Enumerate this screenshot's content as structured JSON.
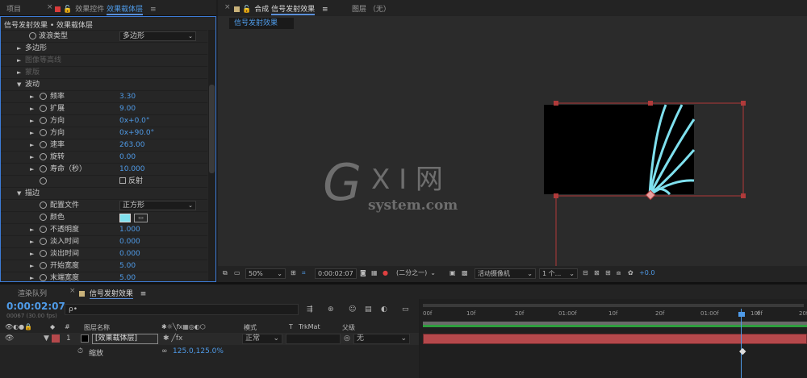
{
  "left_tabs": {
    "project": "项目",
    "effect_controls_prefix": "效果控件",
    "effect_controls_layer": "效果载体层"
  },
  "right_tabs": {
    "comp_prefix": "合成",
    "comp_name": "信号发射效果",
    "layer_label": "图层 （无）",
    "comp_subtab": "信号发射效果"
  },
  "effect_controls": {
    "title": "信号发射效果 • 效果载体层",
    "wave_type_label": "波浪类型",
    "wave_type_value": "多边形",
    "polygon": "多边形",
    "image_contour": "图像等高线",
    "mask": "蒙版",
    "wave_motion": "波动",
    "frequency_label": "频率",
    "frequency_value": "3.30",
    "expansion_label": "扩展",
    "expansion_value": "9.00",
    "direction1_label": "方向",
    "direction1_value": "0x+0.0°",
    "direction2_label": "方向",
    "direction2_value": "0x+90.0°",
    "velocity_label": "速率",
    "velocity_value": "263.00",
    "spin_label": "旋转",
    "spin_value": "0.00",
    "lifespan_label": "寿命（秒）",
    "lifespan_value": "10.000",
    "reflection_label": "反射",
    "stroke": "描边",
    "profile_label": "配置文件",
    "profile_value": "正方形",
    "color_label": "颜色",
    "color_value": "#7fe0ee",
    "opacity_label": "不透明度",
    "opacity_value": "1.000",
    "fade_in_label": "淡入时间",
    "fade_in_value": "0.000",
    "fade_out_label": "淡出时间",
    "fade_out_value": "0.000",
    "start_width_label": "开始宽度",
    "start_width_value": "5.00",
    "end_width_label": "末端宽度",
    "end_width_value": "5.00"
  },
  "viewer": {
    "watermark_g": "G",
    "watermark_xi": "X I 网",
    "watermark_domain": "system.com",
    "wave_color": "#7fe0ee"
  },
  "viewer_toolbar": {
    "zoom": "50%",
    "time": "0:00:02:07",
    "resolution": "(二分之一)",
    "camera": "活动摄像机",
    "views": "1 个...",
    "exposure": "+0.0"
  },
  "timeline": {
    "render_queue_tab": "渲染队列",
    "comp_tab": "信号发射效果",
    "timecode": "0:00:02:07",
    "fps": "00067 (30.00 fps)",
    "search_placeholder": "ρ•",
    "col_num": "#",
    "col_layer_name": "图层名称",
    "col_mode": "模式",
    "col_t": "T",
    "col_trkmat": "TrkMat",
    "col_parent": "父级",
    "layer_index": "1",
    "layer_name": "[效果载体层]",
    "layer_mode": "正常",
    "layer_parent": "无",
    "scale_label": "缩放",
    "scale_value": "125.0,125.0%",
    "ruler": [
      "00f",
      "10f",
      "20f",
      "01:00f",
      "10f",
      "20f",
      "01:00f",
      "10f",
      "0f",
      "20f"
    ],
    "layer_bar_color": "#b5484b",
    "accent_blue": "#4f9be8"
  }
}
